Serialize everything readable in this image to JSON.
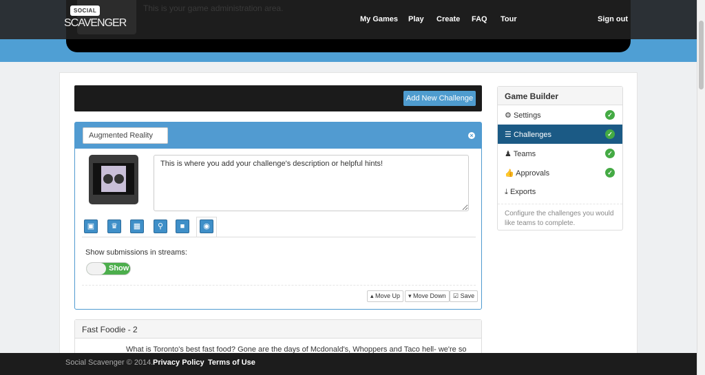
{
  "header": {
    "logo_top": "SOCIAL",
    "logo_bottom": "SCAVENGER",
    "subtitle": "This is your game administration area.",
    "nav": [
      "My Games",
      "Play",
      "Create",
      "FAQ",
      "Tour"
    ],
    "sign_out": "Sign out"
  },
  "toolbar": {
    "add_challenge": "Add New Challenge"
  },
  "challenge": {
    "title_value": "Augmented Reality",
    "description": "This is where you add your challenge's description or helpful hints!",
    "tabs": [
      "image-icon",
      "trophy-icon",
      "calendar-icon",
      "map-marker-icon",
      "lock-icon",
      "eye-icon"
    ],
    "stream_label": "Show submissions in streams:",
    "toggle_label": "Show",
    "toggle_on": true,
    "move_up": "Move Up",
    "move_down": "Move Down",
    "save": "Save"
  },
  "next_challenge": {
    "title": "Fast Foodie - 2",
    "text": "What is Toronto's best fast food? Gone are the days of Mcdonald's, Whoppers and Taco hell- we're so over it."
  },
  "sidebar": {
    "title": "Game Builder",
    "items": [
      {
        "label": "Settings",
        "icon": "gear-icon",
        "done": true
      },
      {
        "label": "Challenges",
        "icon": "list-icon",
        "done": true,
        "active": true
      },
      {
        "label": "Teams",
        "icon": "user-icon",
        "done": true
      },
      {
        "label": "Approvals",
        "icon": "thumbs-up-icon",
        "done": true
      },
      {
        "label": "Exports",
        "icon": "download-icon",
        "done": false
      }
    ],
    "help": "Configure the challenges you would like teams to complete."
  },
  "footer": {
    "copyright": "Social Scavenger © 2014.",
    "privacy": "Privacy Policy",
    "terms": "Terms of Use"
  },
  "colors": {
    "accent": "#519bd1",
    "active": "#1b5a85",
    "success": "#44aa44"
  }
}
